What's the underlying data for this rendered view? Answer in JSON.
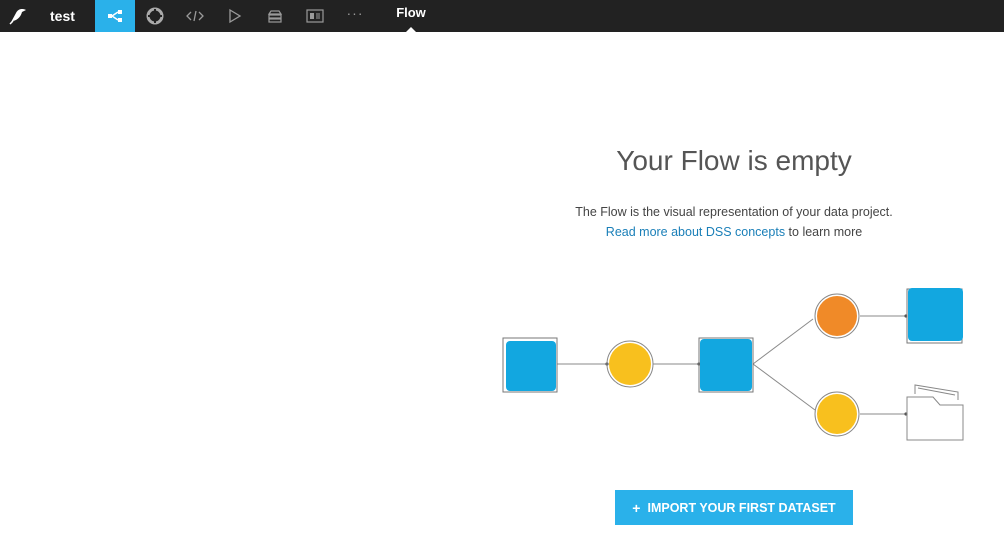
{
  "topbar": {
    "project_name": "test",
    "section_title": "Flow",
    "nav_icons": [
      "flow-icon",
      "lifebuoy-icon",
      "code-icon",
      "play-icon",
      "stack-icon",
      "dashboard-icon",
      "more-icon"
    ],
    "more_label": "···"
  },
  "empty_state": {
    "title": "Your Flow is empty",
    "description": "The Flow is the visual representation of your data project.",
    "link_text": "Read more about DSS concepts",
    "link_suffix": " to learn more"
  },
  "import_button": {
    "icon": "+",
    "label": "IMPORT YOUR FIRST DATASET"
  },
  "colors": {
    "topbar_bg": "#222222",
    "accent": "#2ab1ea",
    "dataset_blue": "#12a7e0",
    "recipe_yellow": "#f8c01e",
    "recipe_orange": "#f08a28",
    "link": "#1a7fb8"
  }
}
